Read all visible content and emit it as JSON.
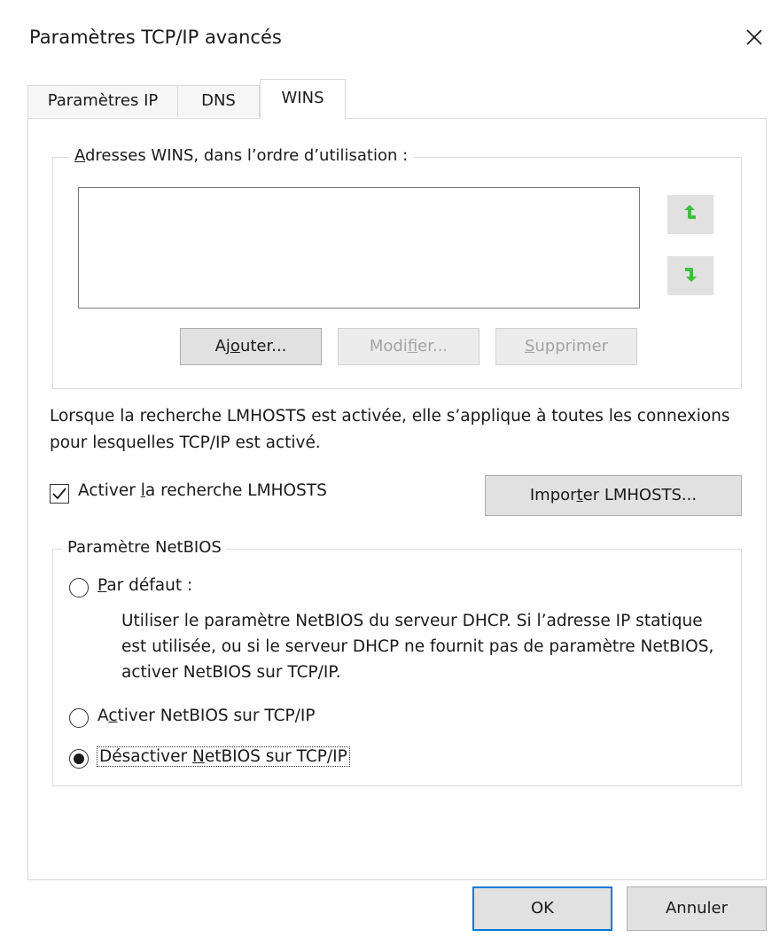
{
  "window": {
    "title": "Paramètres TCP/IP avancés",
    "close_icon": "close-icon"
  },
  "tabs": [
    {
      "label": "Paramètres IP",
      "selected": false
    },
    {
      "label": "DNS",
      "selected": false
    },
    {
      "label": "WINS",
      "selected": true
    }
  ],
  "wins": {
    "group_label": "Adresses WINS, dans l’ordre d’utilisation :",
    "addresses": [],
    "move_up_icon": "arrow-up-icon",
    "move_down_icon": "arrow-down-icon",
    "arrow_color": "#3fbf3f",
    "buttons": {
      "add": "Ajouter...",
      "edit": "Modifier...",
      "remove": "Supprimer"
    }
  },
  "lmhosts": {
    "info_text": "Lorsque la recherche LMHOSTS est activée, elle s’applique à toutes les connexions pour lesquelles TCP/IP est activé.",
    "checkbox_label": "Activer la recherche LMHOSTS",
    "checked": true,
    "import_button": "Importer LMHOSTS..."
  },
  "netbios": {
    "group_label": "Paramètre NetBIOS",
    "options": [
      {
        "label": "Par défaut :",
        "selected": false
      },
      {
        "label": "Activer NetBIOS sur TCP/IP",
        "selected": false
      },
      {
        "label": "Désactiver NetBIOS sur TCP/IP",
        "selected": true
      }
    ],
    "default_description": "Utiliser le paramètre NetBIOS du serveur DHCP. Si l’adresse IP statique est utilisée, ou si le serveur DHCP ne fournit pas de paramètre NetBIOS, activer NetBIOS sur TCP/IP."
  },
  "footer": {
    "ok": "OK",
    "cancel": "Annuler",
    "accent_color": "#0078d7"
  }
}
